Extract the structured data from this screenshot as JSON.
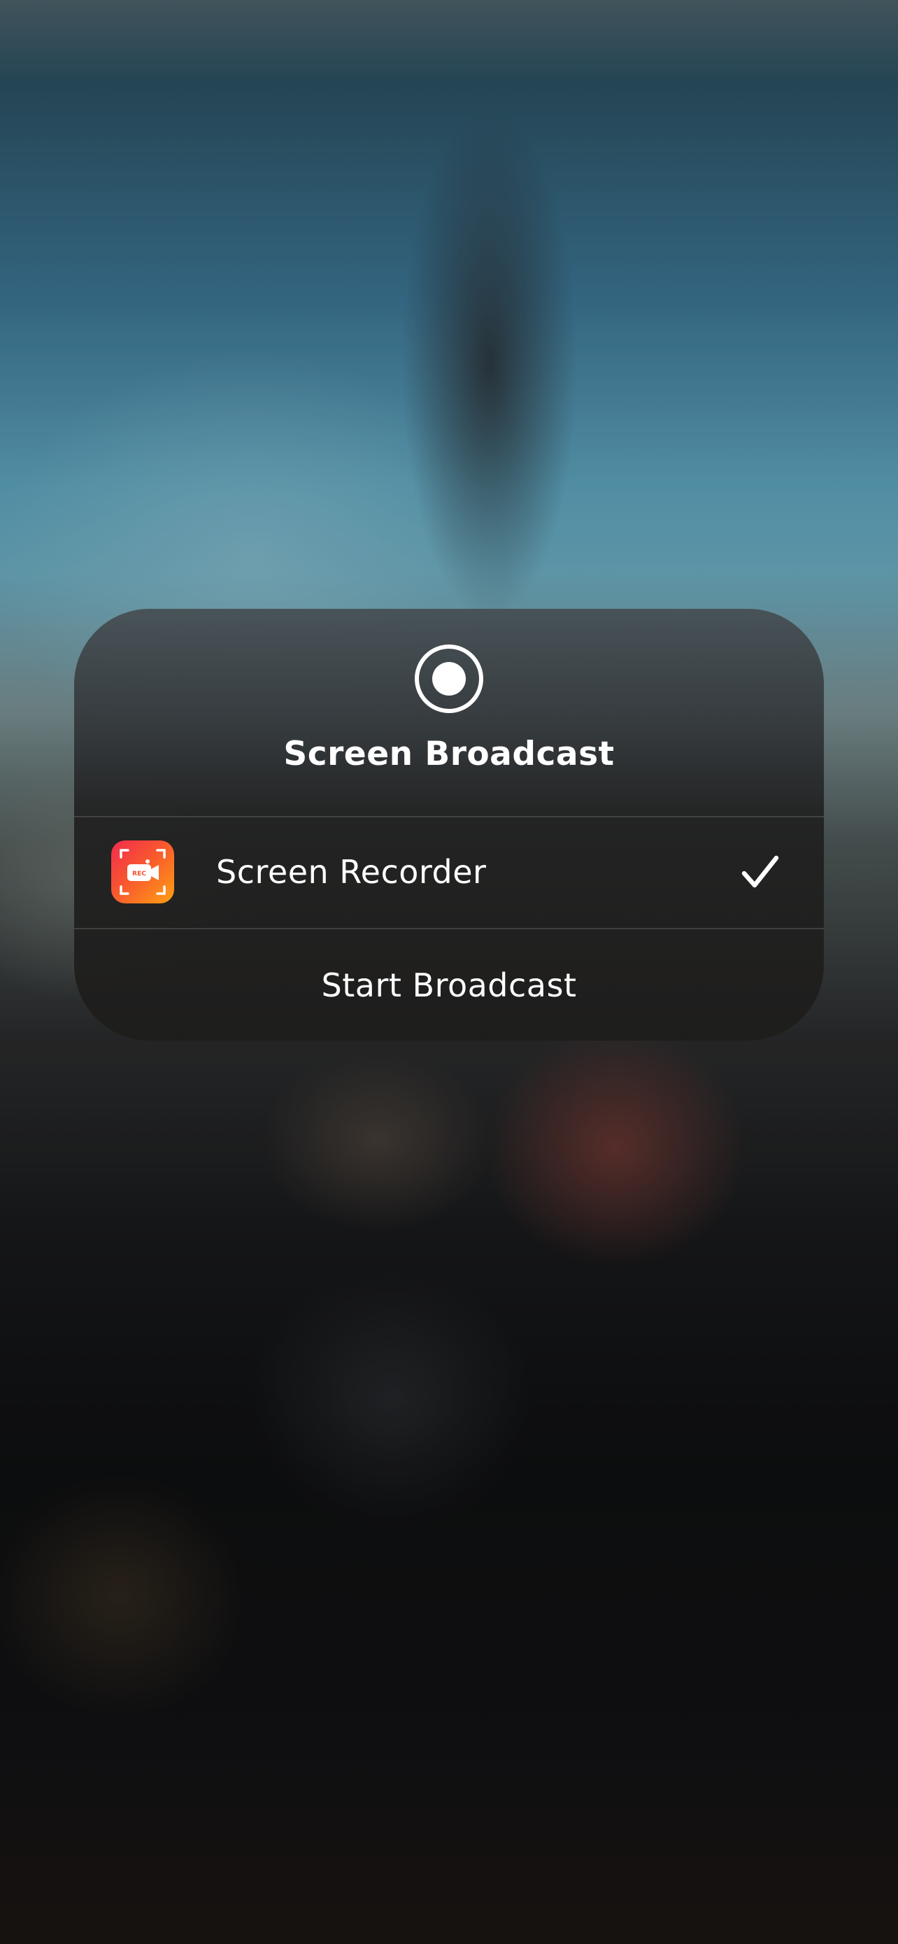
{
  "sheet": {
    "title": "Screen Broadcast",
    "record_icon": "record-icon"
  },
  "apps": [
    {
      "name": "Screen Recorder",
      "icon": "screen-recorder-app-icon",
      "icon_text": "REC",
      "selected": true,
      "selected_icon": "checkmark-icon"
    }
  ],
  "actions": {
    "start_label": "Start Broadcast"
  },
  "colors": {
    "app_icon_gradient": [
      "#f22b4e",
      "#ffa012"
    ],
    "text": "#ffffff"
  }
}
